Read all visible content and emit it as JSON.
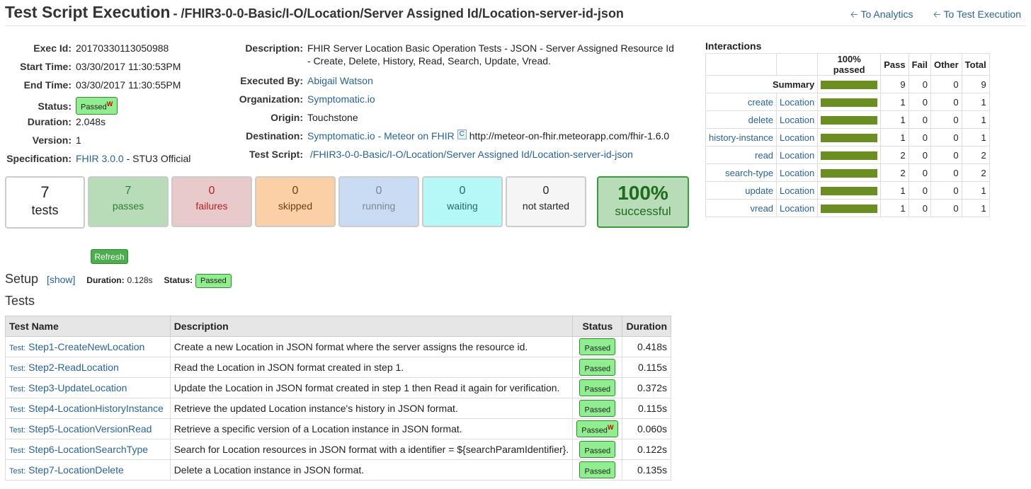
{
  "header": {
    "title": "Test Script Execution",
    "path": "- /FHIR3-0-0-Basic/I-O/Location/Server Assigned Id/Location-server-id-json",
    "nav_analytics": "To Analytics",
    "nav_test_execution": "To Test Execution"
  },
  "left": {
    "exec_id_label": "Exec Id:",
    "exec_id": "20170330113050988",
    "start_label": "Start Time:",
    "start": "03/30/2017 11:30:53PM",
    "end_label": "End Time:",
    "end": "03/30/2017 11:30:55PM",
    "status_label": "Status:",
    "status": "Passed",
    "status_sup": "W",
    "duration_label": "Duration:",
    "duration": "2.048s",
    "version_label": "Version:",
    "version": "1",
    "spec_label": "Specification:",
    "spec_link": "FHIR 3.0.0",
    "spec_rest": "- STU3 Official"
  },
  "mid": {
    "desc_label": "Description:",
    "desc_line1": "FHIR Server Location Basic Operation Tests - JSON - Server Assigned Resource Id",
    "desc_line2": "- Create, Delete, History, Read, Search, Update, Vread.",
    "executed_label": "Executed By:",
    "executed": "Abigail Watson",
    "org_label": "Organization:",
    "org": "Symptomatic.io",
    "origin_label": "Origin:",
    "origin": "Touchstone",
    "dest_label": "Destination:",
    "dest_link": "Symptomatic.io - Meteor on FHIR",
    "dest_c": "C",
    "dest_url": "http://meteor-on-fhir.meteorapp.com/fhir-1.6.0",
    "script_label": "Test Script:",
    "script": "/FHIR3-0-0-Basic/I-O/Location/Server Assigned Id/Location-server-id-json"
  },
  "summary": {
    "tests_num": "7",
    "tests_lbl": "tests",
    "passes_num": "7",
    "passes_lbl": "passes",
    "failures_num": "0",
    "failures_lbl": "failures",
    "skipped_num": "0",
    "skipped_lbl": "skipped",
    "running_num": "0",
    "running_lbl": "running",
    "waiting_num": "0",
    "waiting_lbl": "waiting",
    "notstarted_num": "0",
    "notstarted_lbl": "not started",
    "success_pct": "100%",
    "success_lbl": "successful"
  },
  "refresh_label": "Refresh",
  "setup": {
    "title": "Setup",
    "show": "[show]",
    "duration_label": "Duration:",
    "duration": "0.128s",
    "status_label": "Status:",
    "status": "Passed"
  },
  "tests_title": "Tests",
  "tests_table": {
    "headers": [
      "Test Name",
      "Description",
      "Status",
      "Duration"
    ],
    "prefix": "Test:",
    "rows": [
      {
        "name": "Step1-CreateNewLocation",
        "desc": "Create a new Location in JSON format where the server assigns the resource id.",
        "status": "Passed",
        "sup": "",
        "duration": "0.418s"
      },
      {
        "name": "Step2-ReadLocation",
        "desc": "Read the Location in JSON format created in step 1.",
        "status": "Passed",
        "sup": "",
        "duration": "0.115s"
      },
      {
        "name": "Step3-UpdateLocation",
        "desc": "Update the Location in JSON format created in step 1 then Read it again for verification.",
        "status": "Passed",
        "sup": "",
        "duration": "0.372s"
      },
      {
        "name": "Step4-LocationHistoryInstance",
        "desc": "Retrieve the updated Location instance's history in JSON format.",
        "status": "Passed",
        "sup": "",
        "duration": "0.115s"
      },
      {
        "name": "Step5-LocationVersionRead",
        "desc": "Retrieve a specific version of a Location instance in JSON format.",
        "status": "Passed",
        "sup": "W",
        "duration": "0.060s"
      },
      {
        "name": "Step6-LocationSearchType",
        "desc": "Search for Location resources in JSON format with a identifier = ${searchParamIdentifier}.",
        "status": "Passed",
        "sup": "",
        "duration": "0.122s"
      },
      {
        "name": "Step7-LocationDelete",
        "desc": "Delete a Location instance in JSON format.",
        "status": "Passed",
        "sup": "",
        "duration": "0.135s"
      }
    ]
  },
  "interactions": {
    "title": "Interactions",
    "headers": [
      "100% passed",
      "Pass",
      "Fail",
      "Other",
      "Total"
    ],
    "summary": {
      "label": "Summary",
      "pass": "9",
      "fail": "0",
      "other": "0",
      "total": "9"
    },
    "rows": [
      {
        "op": "create",
        "res": "Location",
        "pass": "1",
        "fail": "0",
        "other": "0",
        "total": "1"
      },
      {
        "op": "delete",
        "res": "Location",
        "pass": "1",
        "fail": "0",
        "other": "0",
        "total": "1"
      },
      {
        "op": "history-instance",
        "res": "Location",
        "pass": "1",
        "fail": "0",
        "other": "0",
        "total": "1"
      },
      {
        "op": "read",
        "res": "Location",
        "pass": "2",
        "fail": "0",
        "other": "0",
        "total": "2"
      },
      {
        "op": "search-type",
        "res": "Location",
        "pass": "2",
        "fail": "0",
        "other": "0",
        "total": "2"
      },
      {
        "op": "update",
        "res": "Location",
        "pass": "1",
        "fail": "0",
        "other": "0",
        "total": "1"
      },
      {
        "op": "vread",
        "res": "Location",
        "pass": "1",
        "fail": "0",
        "other": "0",
        "total": "1"
      }
    ]
  }
}
